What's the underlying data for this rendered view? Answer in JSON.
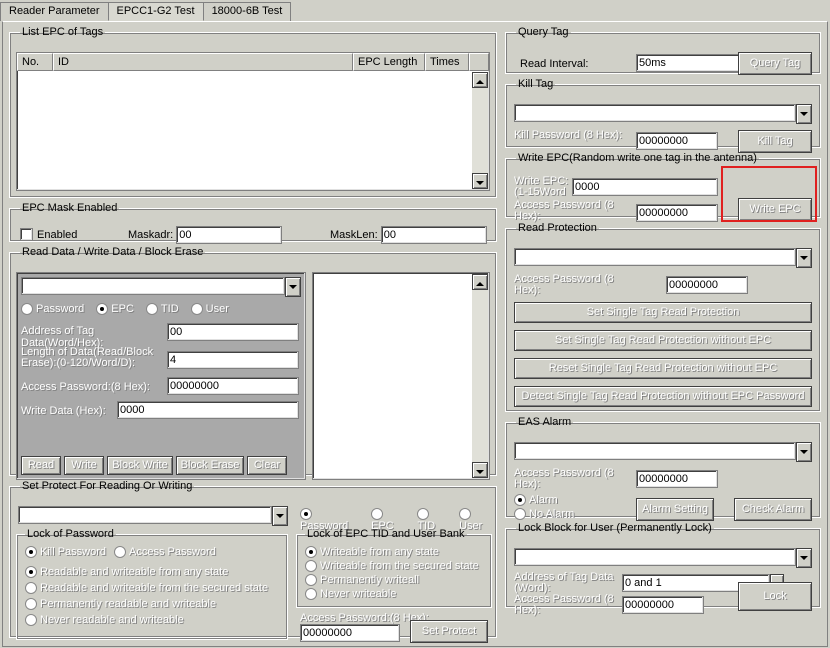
{
  "tabs": {
    "t0": "Reader Parameter",
    "t1": "EPCC1-G2 Test",
    "t2": "18000-6B Test"
  },
  "listEpc": {
    "legend": "List EPC of Tags",
    "cols": {
      "no": "No.",
      "id": "ID",
      "len": "EPC Length",
      "times": "Times"
    }
  },
  "mask": {
    "legend": "EPC Mask Enabled",
    "enabled": "Enabled",
    "adrLbl": "Maskadr:",
    "adrVal": "00",
    "lenLbl": "MaskLen:",
    "lenVal": "00"
  },
  "rw": {
    "legend": "Read Data / Write Data / Block Erase",
    "radios": {
      "pwd": "Password",
      "epc": "EPC",
      "tid": "TID",
      "user": "User"
    },
    "addrLbl": "Address of Tag Data(Word/Hex):",
    "addrVal": "00",
    "lenLbl": "Length of Data(Read/Block Erase):(0-120/Word/D):",
    "lenVal": "4",
    "pwdLbl": "Access Password:(8 Hex):",
    "pwdVal": "00000000",
    "wrLbl": "Write Data (Hex):",
    "wrVal": "0000",
    "btns": {
      "read": "Read",
      "write": "Write",
      "blockw": "Block Write",
      "blocke": "Block Erase",
      "clear": "Clear"
    }
  },
  "protect": {
    "legend": "Set Protect For Reading Or Writing",
    "lockPwd": {
      "legend": "Lock of Password",
      "kill": "Kill Password",
      "access": "Access Password",
      "r0": "Readable and  writeable from any state",
      "r1": "Readable and writeable from the secured state",
      "r2": "Permanently readable and writeable",
      "r3": "Never readable and writeable"
    },
    "lockBank": {
      "legend": "Lock of EPC TID and User Bank",
      "r0": "Writeable from any state",
      "r1": "Writeable from the secured state",
      "r2": "Permanently writeall",
      "r3": "Never writeable"
    },
    "radios2": {
      "pwd": "Password",
      "epc": "EPC",
      "tid": "TID",
      "user": "User"
    },
    "pwdLbl": "Access Password:(8 Hex):",
    "pwdVal": "00000000",
    "btn": "Set Protect"
  },
  "query": {
    "legend": "Query Tag",
    "intLbl": "Read Interval:",
    "intVal": "50ms",
    "btn": "Query Tag"
  },
  "kill": {
    "legend": "Kill Tag",
    "pwdLbl": "Kill Password (8 Hex):",
    "pwdVal": "00000000",
    "btn": "Kill Tag"
  },
  "writeEpc": {
    "legend": "Write EPC(Random write one tag in the antenna)",
    "epcLbl": "Write EPC: (1-15Word",
    "epcVal": "0000",
    "pwdLbl": "Access Password (8 Hex):",
    "pwdVal": "00000000",
    "btn": "Write EPC"
  },
  "readProt": {
    "legend": "Read Protection",
    "pwdLbl": "Access Password (8 Hex):",
    "pwdVal": "00000000",
    "b0": "Set Single Tag Read Protection",
    "b1": "Set Single Tag Read Protection without EPC",
    "b2": "Reset Single Tag Read Protection without EPC",
    "b3": "Detect Single Tag Read Protection without EPC Password"
  },
  "eas": {
    "legend": "EAS Alarm",
    "pwdLbl": "Access Password (8 Hex):",
    "pwdVal": "00000000",
    "alarm": "Alarm",
    "noalarm": "No Alarm",
    "btn0": "Alarm Setting",
    "btn1": "Check Alarm"
  },
  "lockBlock": {
    "legend": "Lock Block for User (Permanently Lock)",
    "addrLbl": "Address of Tag Data (Word):",
    "addrVal": "0 and 1",
    "pwdLbl": "Access Password (8 Hex):",
    "pwdVal": "00000000",
    "btn": "Lock"
  }
}
